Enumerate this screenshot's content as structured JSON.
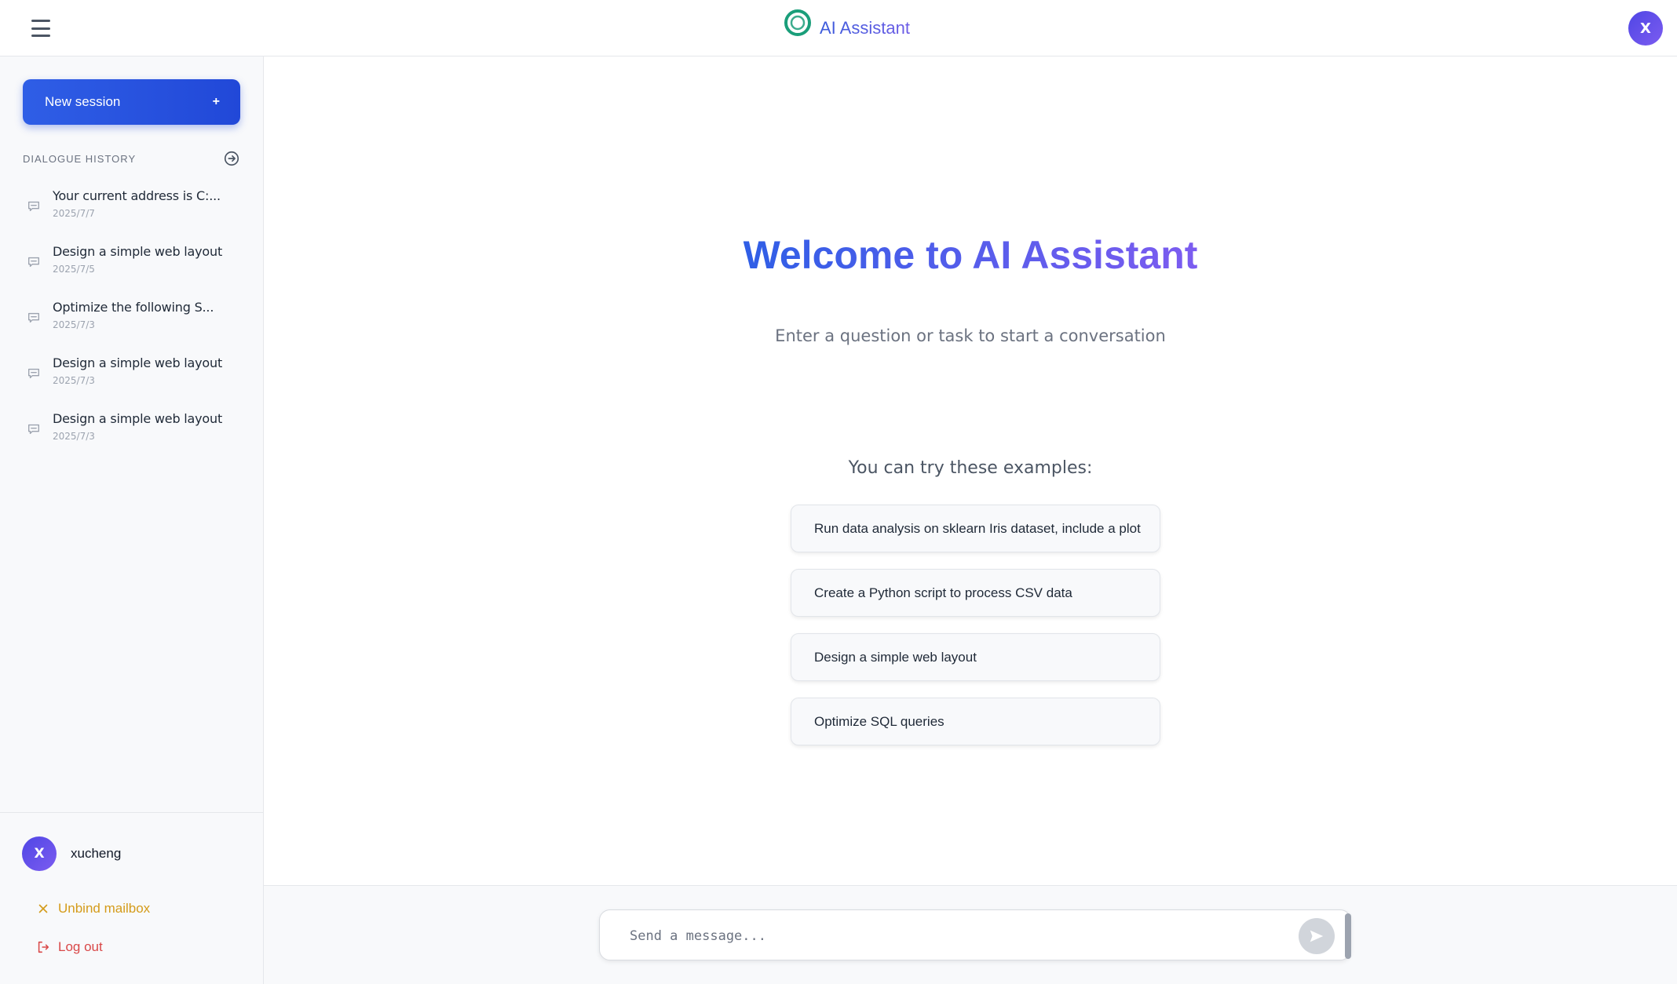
{
  "header": {
    "app_title": "AI Assistant",
    "avatar_initial": "X",
    "icons": {
      "menu": "hamburger-menu-icon",
      "logo": "ring-logo-icon"
    }
  },
  "sidebar": {
    "new_session_label": "New session",
    "new_session_icon": "+",
    "history_title": "DIALOGUE HISTORY",
    "history_action_icon": "arrow-right-circle-icon",
    "history": [
      {
        "title": "Your current address is C:...",
        "date": "2025/7/7"
      },
      {
        "title": "Design a simple web layout",
        "date": "2025/7/5"
      },
      {
        "title": "Optimize the following S...",
        "date": "2025/7/3"
      },
      {
        "title": "Design a simple web layout",
        "date": "2025/7/3"
      },
      {
        "title": "Design a simple web layout",
        "date": "2025/7/3"
      }
    ],
    "user": {
      "avatar_initial": "X",
      "name": "xucheng"
    },
    "unbind_label": "Unbind mailbox",
    "logout_label": "Log out"
  },
  "main": {
    "welcome_title": "Welcome to AI Assistant",
    "subtitle": "Enter a question or task to start a conversation",
    "examples_title": "You can try these examples:",
    "examples": [
      "Run data analysis on sklearn Iris dataset, include a plot",
      "Create a Python script to process CSV data",
      "Design a simple web layout",
      "Optimize SQL queries"
    ]
  },
  "composer": {
    "placeholder": "Send a message...",
    "value": ""
  },
  "colors": {
    "accent": "#2f5ee6",
    "accent_purple": "#7c5cf0",
    "logo_green": "#1a9e7a",
    "unbind": "#d49b1a",
    "logout": "#d94848"
  }
}
